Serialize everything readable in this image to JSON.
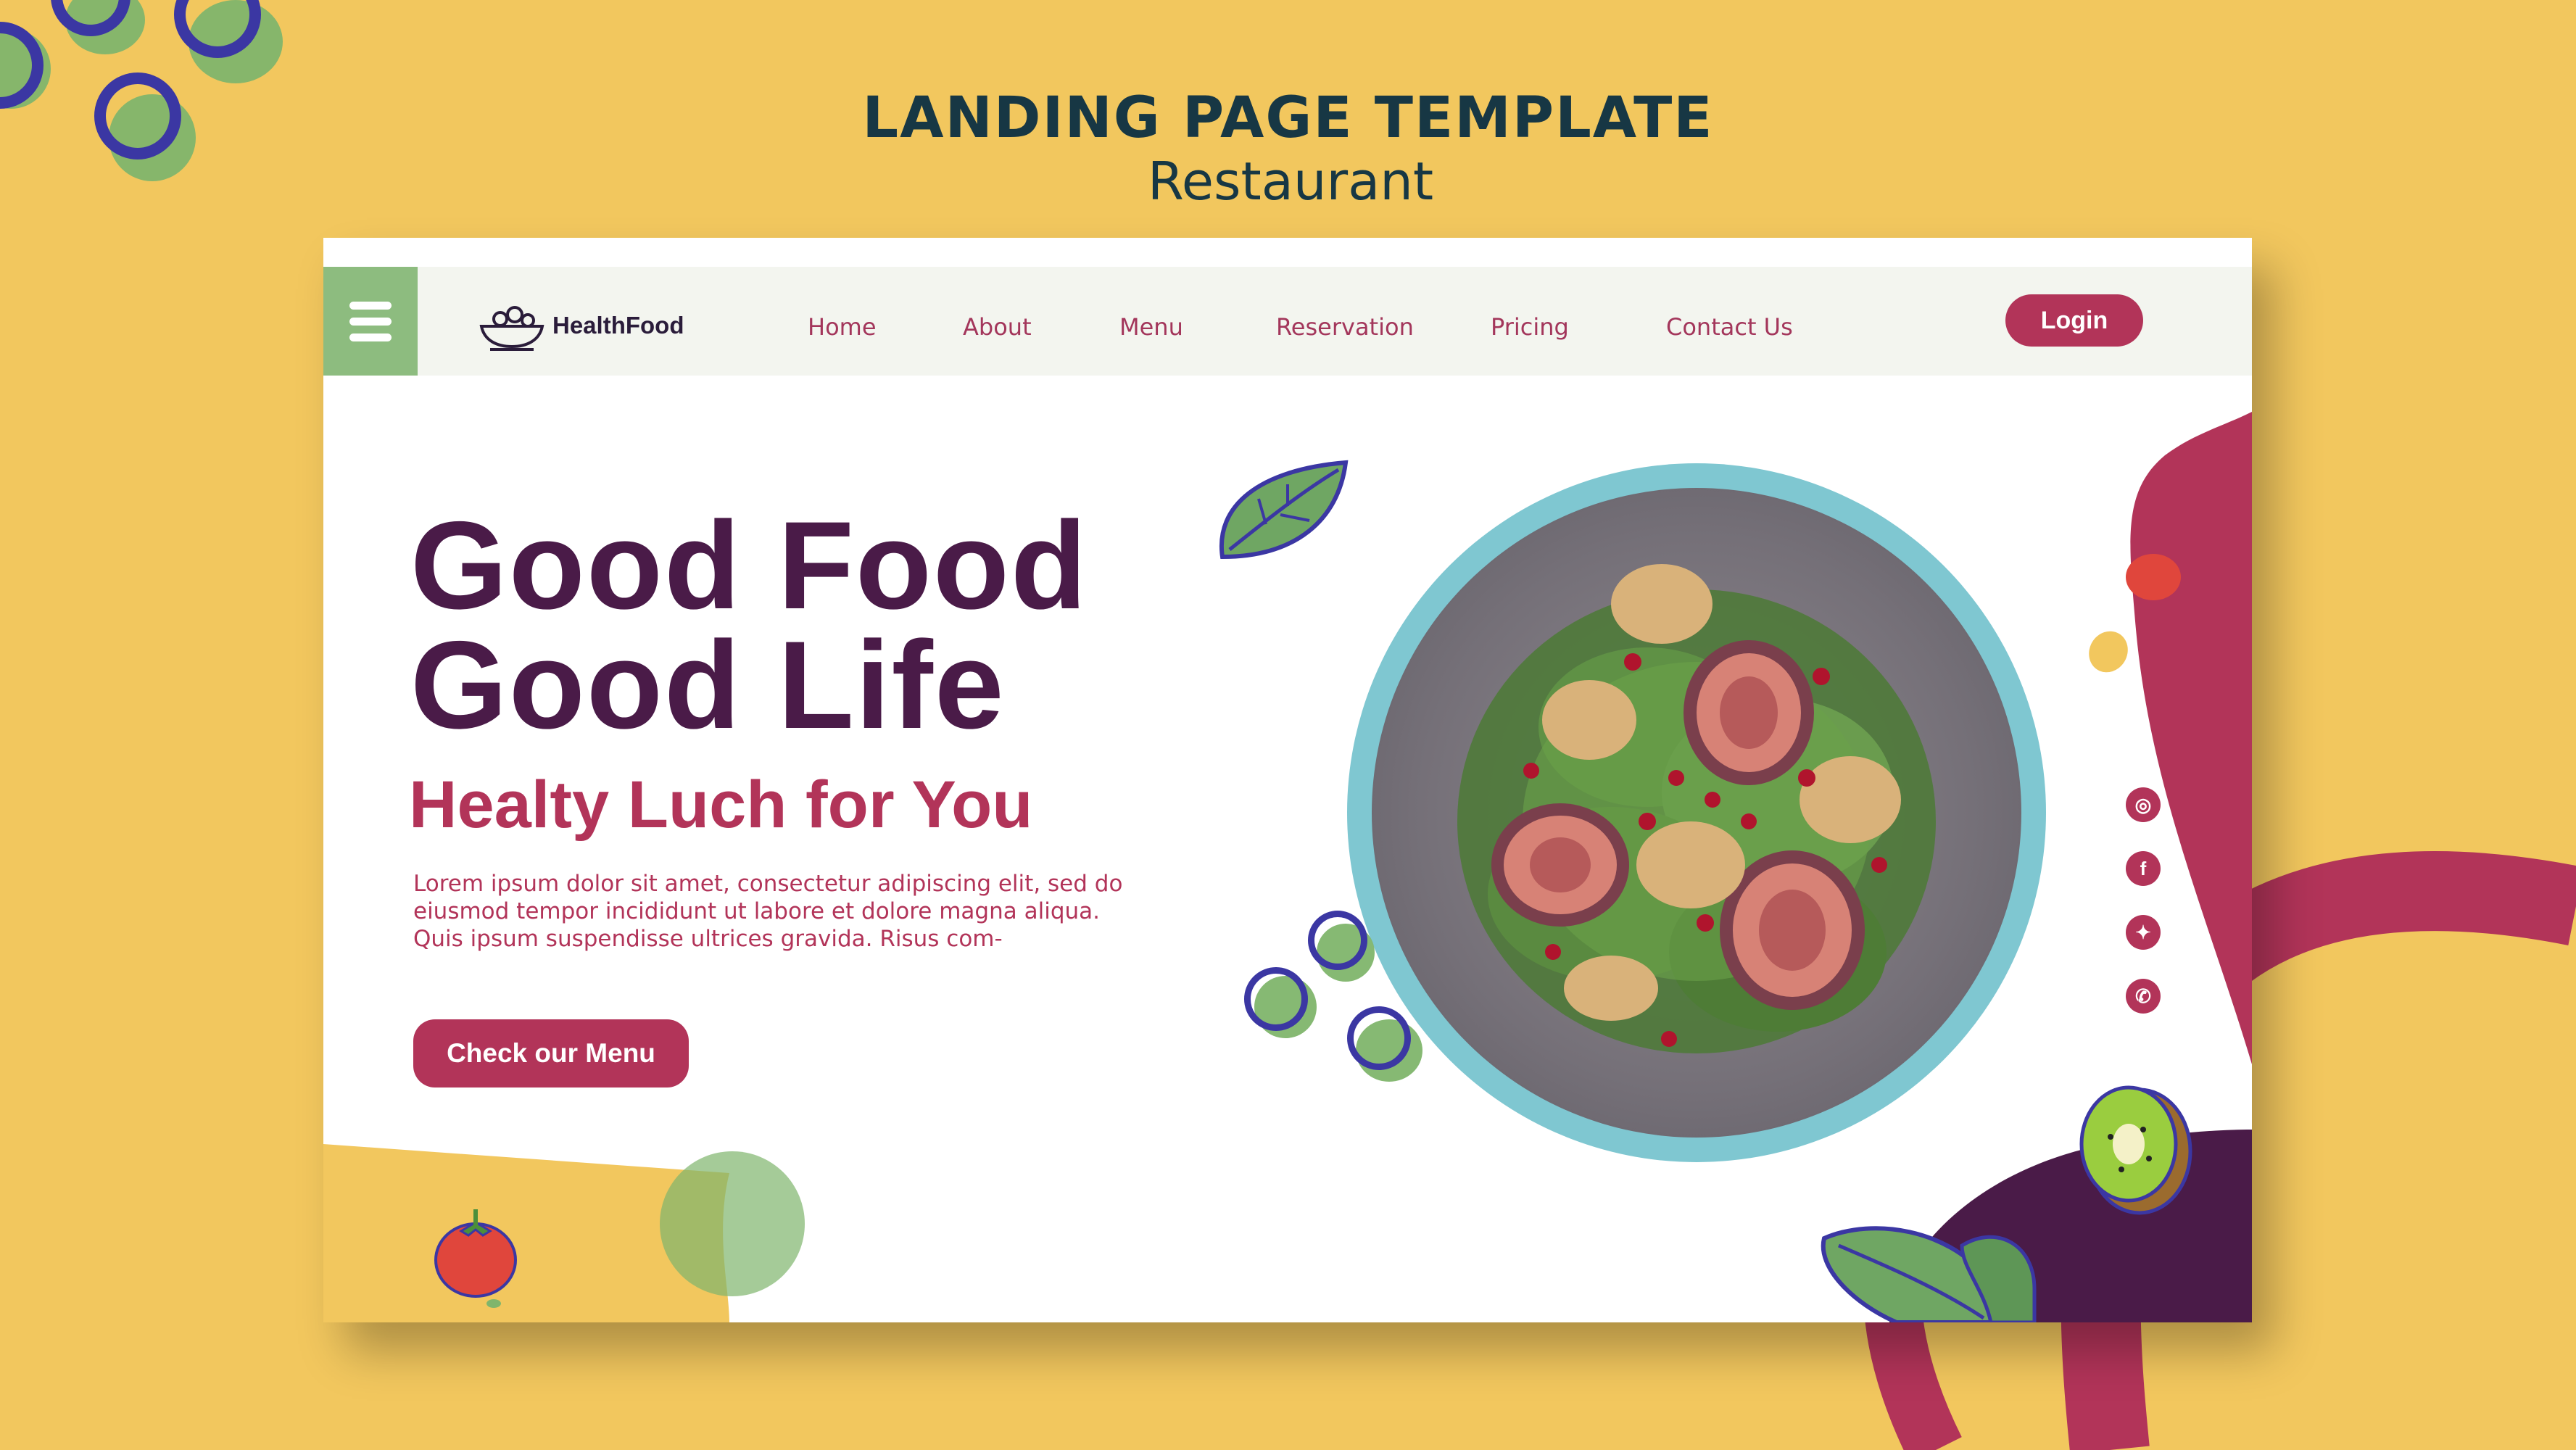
{
  "header": {
    "title": "LANDING PAGE TEMPLATE",
    "subtitle": "Restaurant"
  },
  "nav": {
    "brand": "HealthFood",
    "links": [
      "Home",
      "About",
      "Menu",
      "Reservation",
      "Pricing",
      "Contact Us"
    ],
    "login_label": "Login"
  },
  "hero": {
    "headline_line1": "Good Food",
    "headline_line2": "Good Life",
    "subheadline": "Healty Luch for You",
    "body": "Lorem ipsum dolor sit amet, consectetur adipiscing elit, sed do eiusmod tempor incididunt ut labore et dolore magna aliqua. Quis ipsum suspendisse ultrices gravida. Risus com-",
    "cta_label": "Check our Menu"
  },
  "social": [
    "instagram-icon",
    "facebook-icon",
    "twitter-icon",
    "whatsapp-icon"
  ],
  "colors": {
    "background": "#f2c75e",
    "primary": "#b23459",
    "headline": "#4a1b48",
    "green": "#8dbc7f",
    "navy": "#3b37a3",
    "plate_ring": "#7fc7d1"
  }
}
